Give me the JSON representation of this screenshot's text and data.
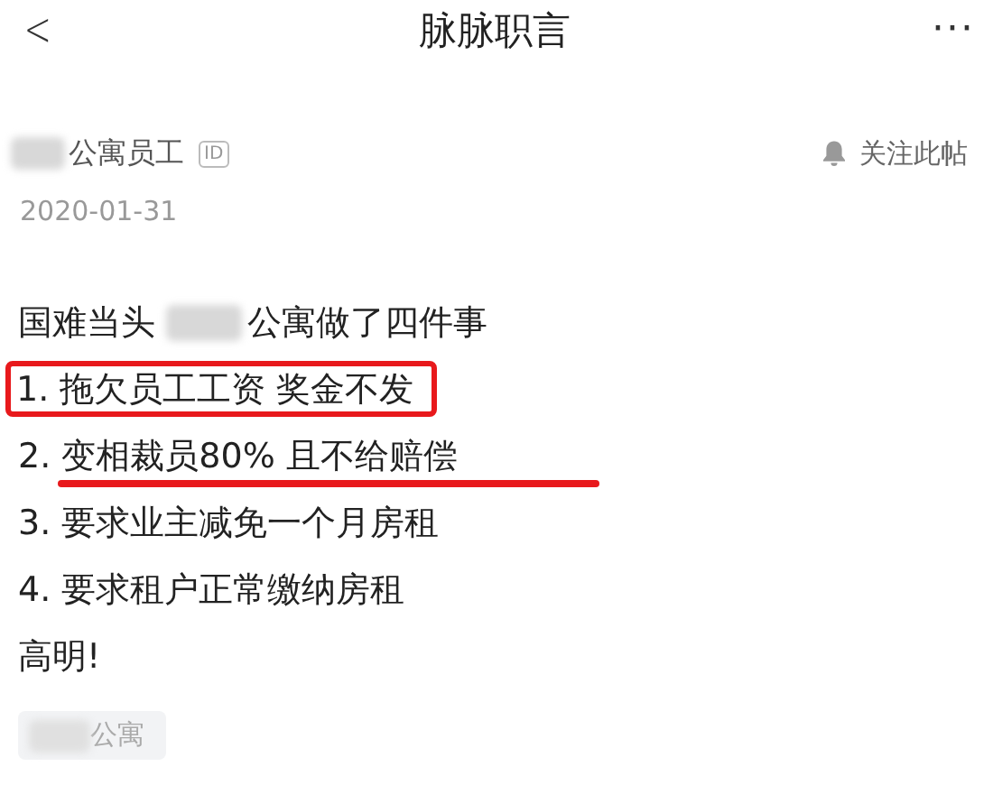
{
  "header": {
    "title": "脉脉职言",
    "back": "<",
    "more": "···"
  },
  "author": {
    "redacted_prefix": true,
    "name": "公寓员工",
    "badge": "ID",
    "follow": "关注此帖"
  },
  "date": "2020-01-31",
  "lines": [
    {
      "boxed": false,
      "underlined": false,
      "parts": [
        {
          "kind": "text",
          "text": "国难当头"
        },
        {
          "kind": "redacted"
        },
        {
          "kind": "text",
          "text": "公寓做了四件事"
        }
      ]
    },
    {
      "boxed": true,
      "underlined": false,
      "parts": [
        {
          "kind": "text",
          "text": "1. 拖欠员工工资 奖金不发"
        }
      ]
    },
    {
      "boxed": false,
      "underlined": true,
      "parts": [
        {
          "kind": "text",
          "text": "2. 变相裁员80% 且不给赔偿"
        }
      ]
    },
    {
      "boxed": false,
      "underlined": false,
      "parts": [
        {
          "kind": "text",
          "text": "3. 要求业主减免一个月房租"
        }
      ]
    },
    {
      "boxed": false,
      "underlined": false,
      "parts": [
        {
          "kind": "text",
          "text": "4. 要求租户正常缴纳房租"
        }
      ]
    },
    {
      "boxed": false,
      "underlined": false,
      "parts": [
        {
          "kind": "text",
          "text": "高明!"
        }
      ]
    }
  ],
  "tag": {
    "redacted_prefix": true,
    "text": "公寓"
  }
}
